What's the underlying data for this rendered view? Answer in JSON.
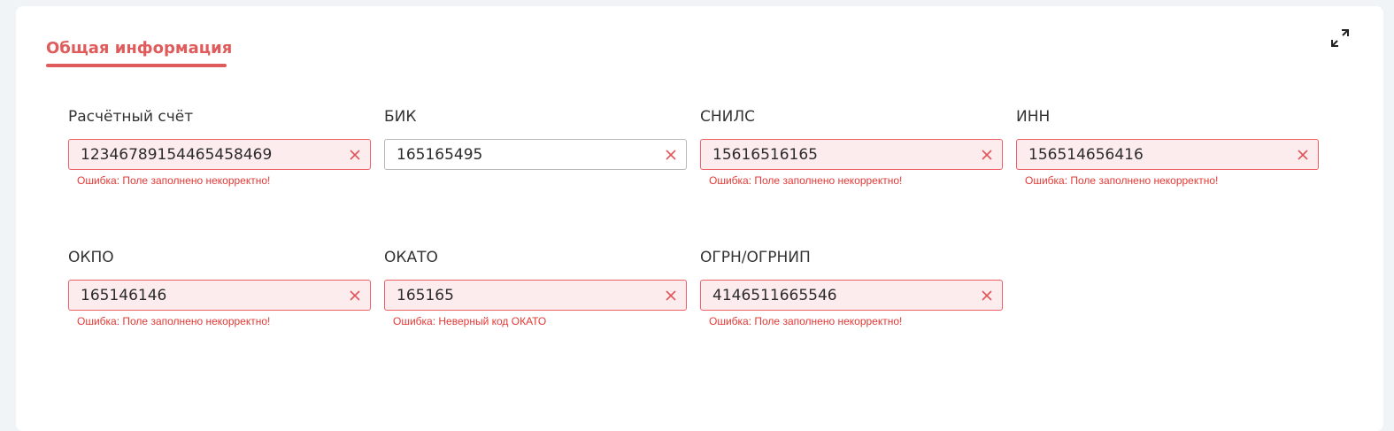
{
  "section": {
    "tab_title": "Общая информация",
    "expand_icon": "expand-icon"
  },
  "colors": {
    "accent": "#e05b5b",
    "error_border": "#ee5f66",
    "error_bg": "#fdeced",
    "error_text": "#e53935"
  },
  "fields": [
    {
      "label": "Расчётный счёт",
      "value": "12346789154465458469",
      "error": "Ошибка: Поле заполнено некорректно!"
    },
    {
      "label": "БИК",
      "value": "165165495",
      "error": ""
    },
    {
      "label": "СНИЛС",
      "value": "15616516165",
      "error": "Ошибка: Поле заполнено некорректно!"
    },
    {
      "label": "ИНН",
      "value": "156514656416",
      "error": "Ошибка: Поле заполнено некорректно!"
    },
    {
      "label": "ОКПО",
      "value": "165146146",
      "error": "Ошибка: Поле заполнено некорректно!"
    },
    {
      "label": "ОКАТО",
      "value": "165165",
      "error": "Ошибка: Неверный код ОКАТО"
    },
    {
      "label": "ОГРН/ОГРНИП",
      "value": "4146511665546",
      "error": "Ошибка: Поле заполнено некорректно!"
    }
  ]
}
